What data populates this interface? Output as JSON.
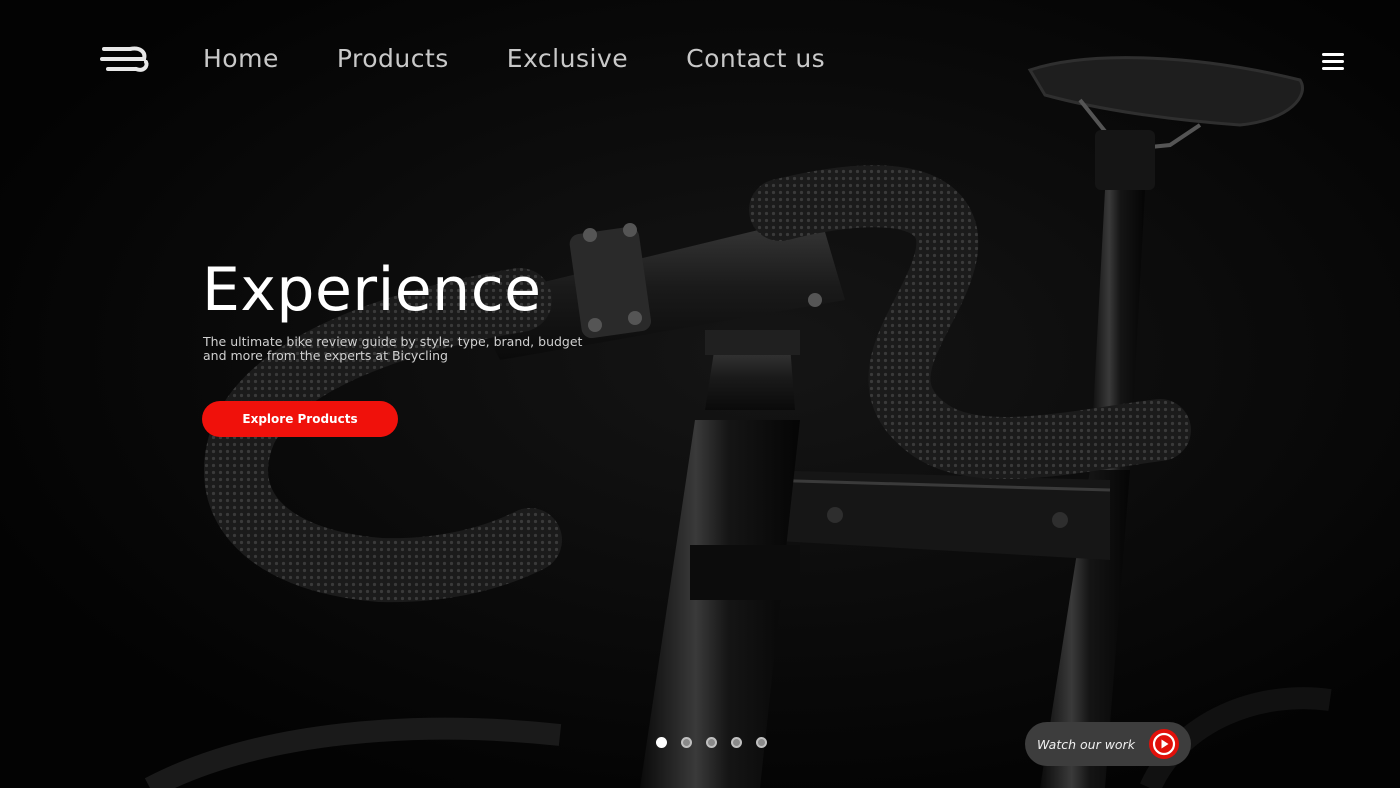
{
  "header": {
    "logo_icon": "wind-lines-logo",
    "nav": [
      "Home",
      "Products",
      "Exclusive",
      "Contact us"
    ],
    "menu_icon": "hamburger-menu-icon"
  },
  "hero": {
    "title": "Experience",
    "subtitle": "The ultimate bike review guide by style, type, brand, budget and more from the experts at Bicycling",
    "cta_label": "Explore Products",
    "background_image": "black-road-bike-closeup"
  },
  "carousel": {
    "total_slides": 5,
    "active_index": 0
  },
  "watch": {
    "label": "Watch our work",
    "icon": "play-icon"
  },
  "colors": {
    "background": "#030303",
    "accent": "#f0110b",
    "nav_text": "#c9c9c9",
    "watch_pill": "#3d3d3d"
  }
}
